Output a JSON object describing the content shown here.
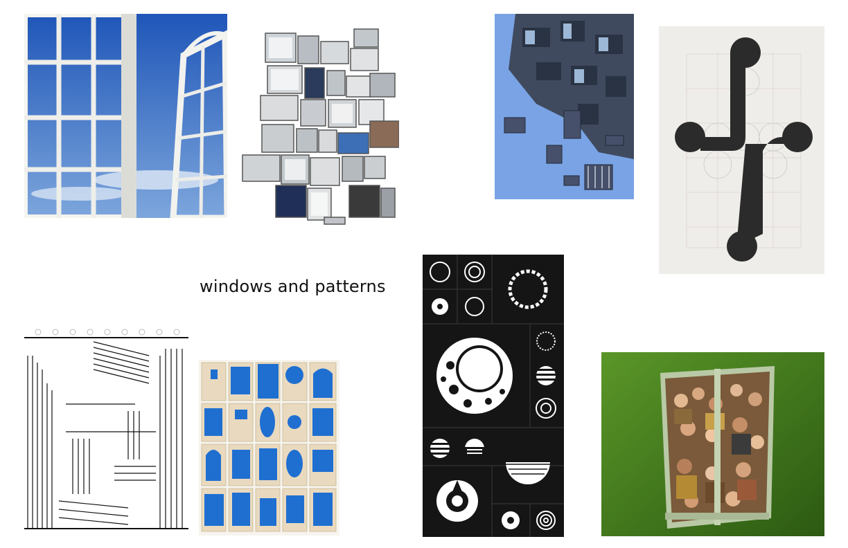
{
  "board": {
    "title": "windows and patterns"
  },
  "palette": {
    "background": "#ffffff",
    "ink": "#111111",
    "sky_blue": "#6a9bd8",
    "collage_blue": "#1f6fd1",
    "green_wall": "#4e8a24"
  },
  "images": [
    {
      "id": "img-open-window",
      "subject": "open white window against blue sky"
    },
    {
      "id": "img-window-collage",
      "subject": "collage of small window photographs"
    },
    {
      "id": "img-building-sky",
      "subject": "modular blue building looking up at sky"
    },
    {
      "id": "img-letterform-poster",
      "subject": "dark rounded letterform on grid paper"
    },
    {
      "id": "img-line-drawing",
      "subject": "hatched ink drawing of stairs and walls"
    },
    {
      "id": "img-blue-cards",
      "subject": "grid of cards with blue window shapes"
    },
    {
      "id": "img-pattern-grid",
      "subject": "black grid of white geometric sphere patterns"
    },
    {
      "id": "img-crowd-window",
      "subject": "green wall window looking down on a crowd"
    }
  ]
}
